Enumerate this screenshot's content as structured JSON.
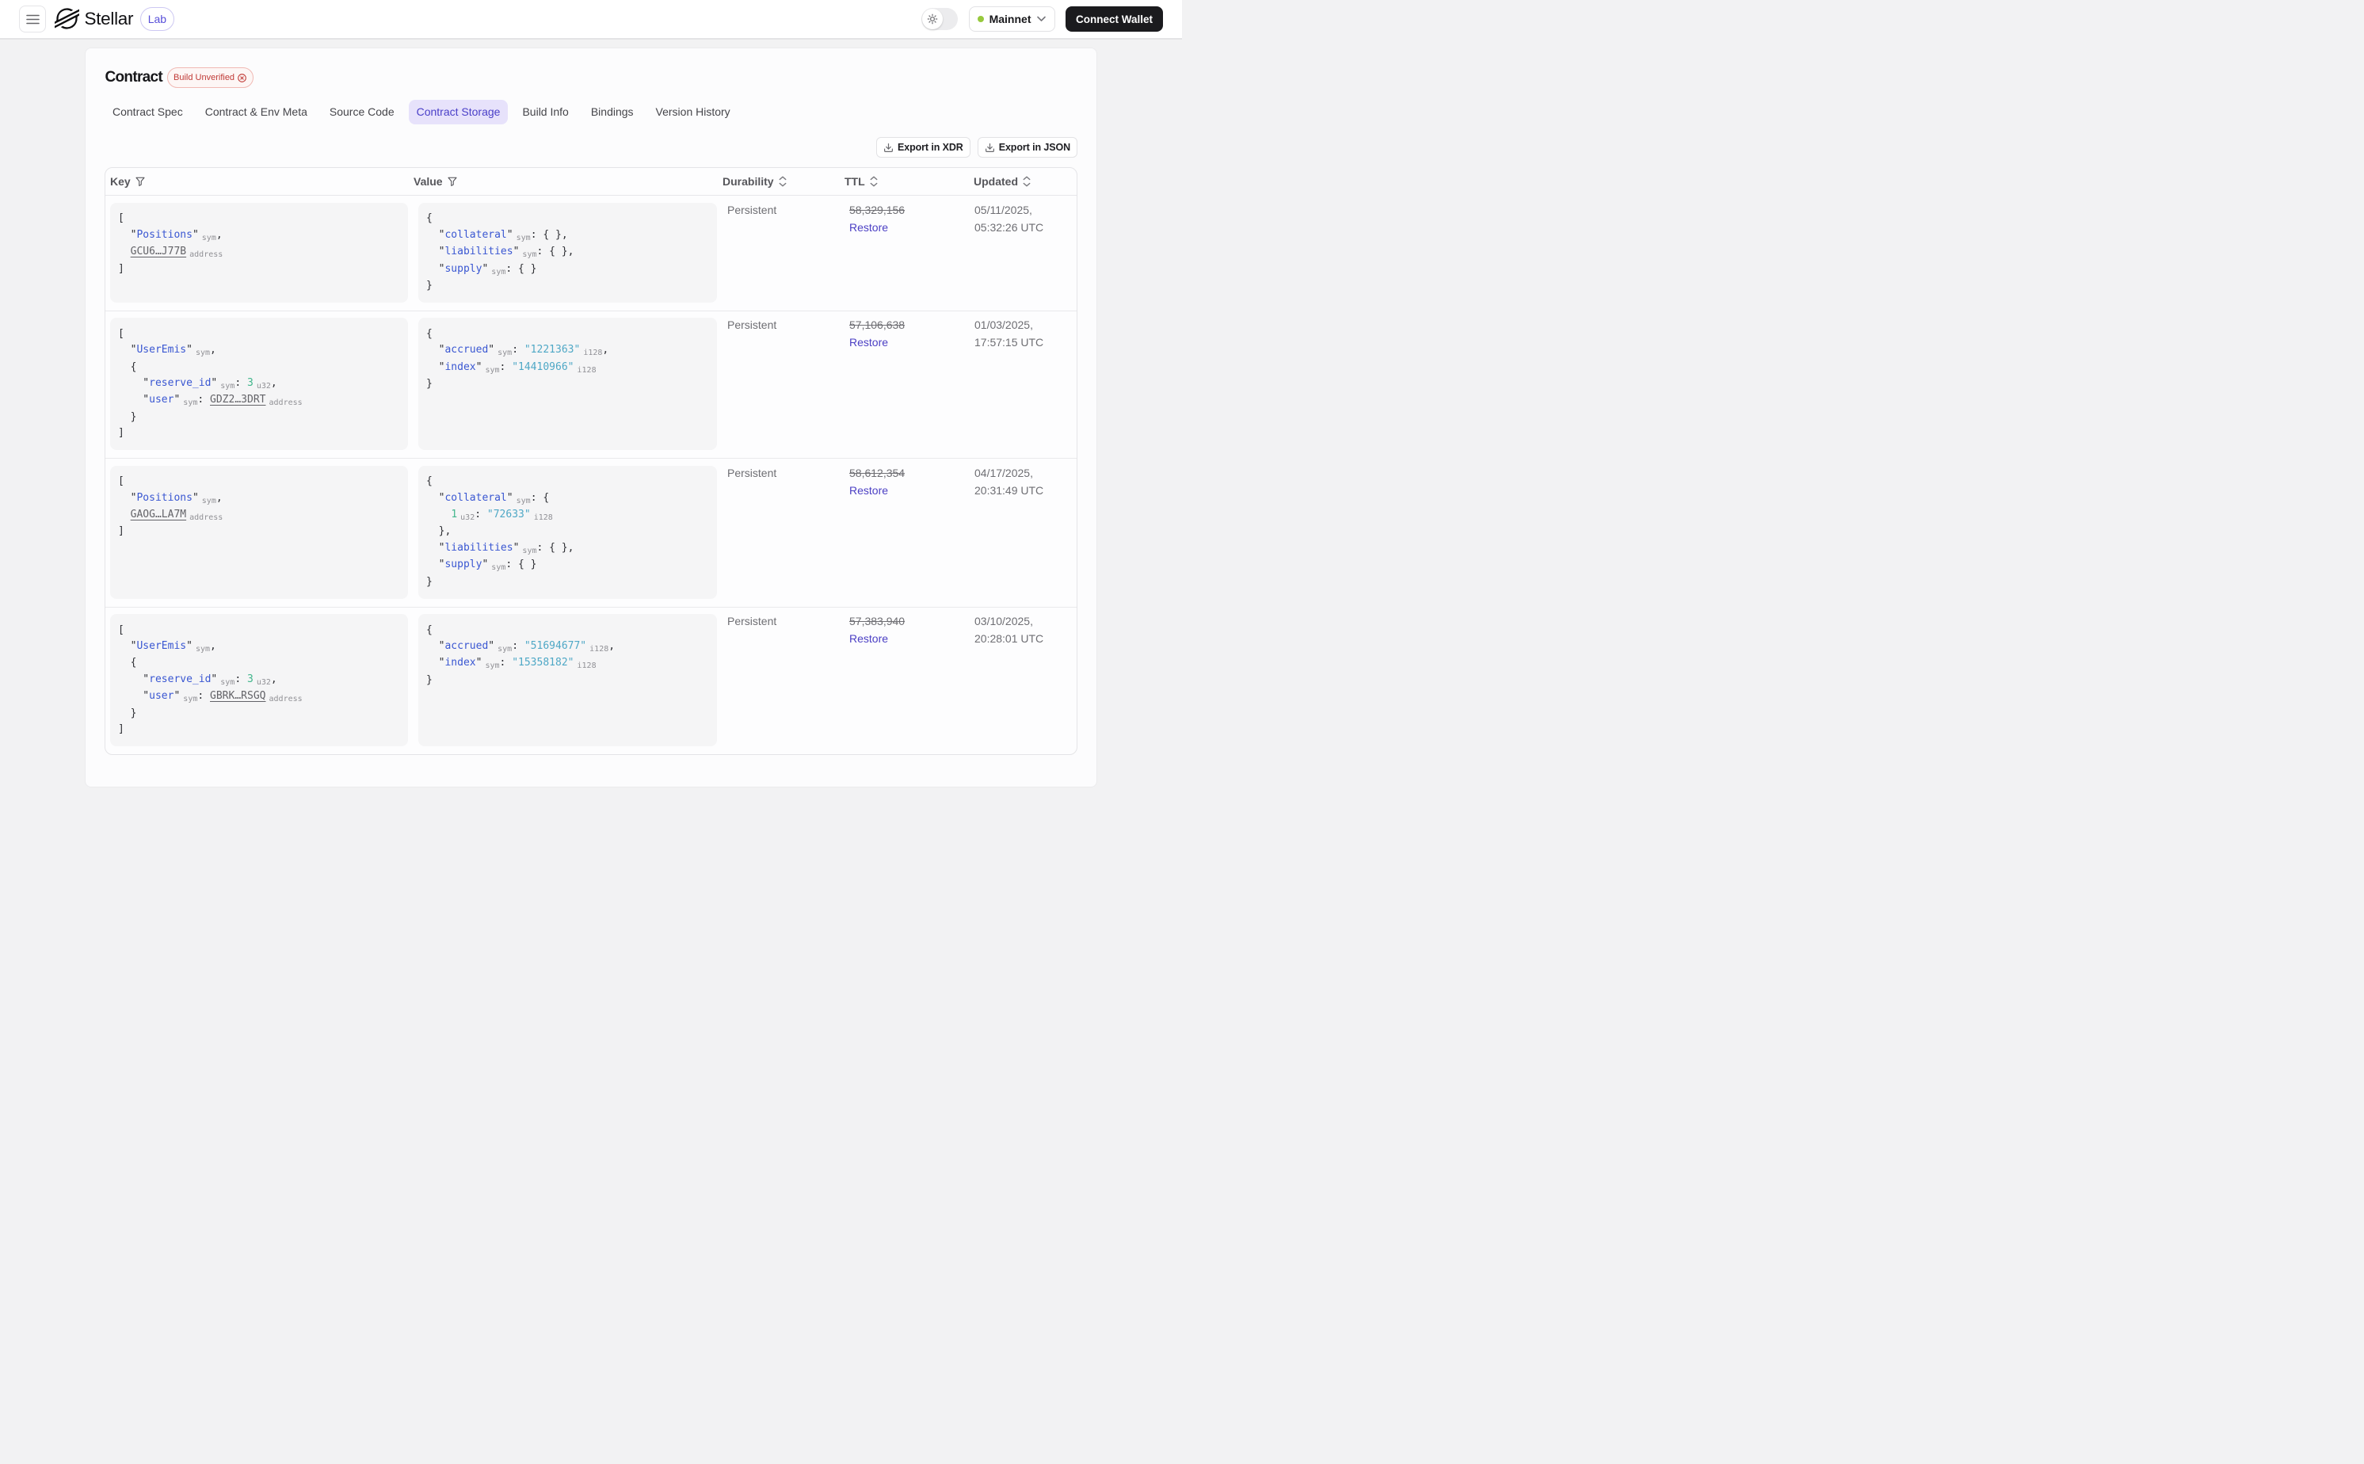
{
  "header": {
    "brand": "Stellar",
    "brand_badge": "Lab",
    "network_label": "Mainnet",
    "connect_wallet_label": "Connect Wallet",
    "icons": {
      "menu": "hamburger-icon",
      "logo": "stellar-logo",
      "theme": "sun-icon",
      "network_status": "green-dot",
      "network_expand": "chevron-down-icon"
    },
    "colors": {
      "connect_bg": "#1b1b1e",
      "network_dot": "#97c93d",
      "lab_accent": "#584fd9"
    }
  },
  "page": {
    "title": "Contract",
    "status_badge": "Build Unverified",
    "status_icon": "circle-x-icon",
    "tabs": [
      {
        "label": "Contract Spec",
        "active": false
      },
      {
        "label": "Contract & Env Meta",
        "active": false
      },
      {
        "label": "Source Code",
        "active": false
      },
      {
        "label": "Contract Storage",
        "active": true
      },
      {
        "label": "Build Info",
        "active": false
      },
      {
        "label": "Bindings",
        "active": false
      },
      {
        "label": "Version History",
        "active": false
      }
    ],
    "toolbar": {
      "export_xdr_label": "Export in XDR",
      "export_json_label": "Export in JSON",
      "export_icon": "download-icon"
    },
    "colors": {
      "tab_active_bg": "#e7e2fb",
      "tab_active_text": "#4a3fc8",
      "badge_red": "#c03a36",
      "restore_link": "#4b3fc4",
      "code_key": "#3a57d2",
      "code_string": "#4fa8c6",
      "code_number": "#41b68c"
    }
  },
  "table": {
    "columns": [
      "Key",
      "Value",
      "Durability",
      "TTL",
      "Updated"
    ],
    "column_icons": [
      "filter-icon",
      "filter-icon",
      "sort-icon",
      "sort-icon",
      "sort-icon"
    ],
    "restore_label": "Restore",
    "rows": [
      {
        "key_lines": [
          [
            {
              "t": "[",
              "c": "p"
            }
          ],
          [
            {
              "t": "  \"",
              "c": "p"
            },
            {
              "t": "Positions",
              "c": "k"
            },
            {
              "t": "\"",
              "c": "p"
            },
            {
              "t": " sym",
              "c": "sub"
            },
            {
              "t": ",",
              "c": "p"
            }
          ],
          [
            {
              "t": "  ",
              "c": "p"
            },
            {
              "t": "GCU6…J77B",
              "c": "link"
            },
            {
              "t": " address",
              "c": "sub"
            }
          ],
          [
            {
              "t": "]",
              "c": "p"
            }
          ]
        ],
        "value_lines": [
          [
            {
              "t": "{",
              "c": "p"
            }
          ],
          [
            {
              "t": "  \"",
              "c": "p"
            },
            {
              "t": "collateral",
              "c": "k"
            },
            {
              "t": "\"",
              "c": "p"
            },
            {
              "t": " sym",
              "c": "sub"
            },
            {
              "t": ": { },",
              "c": "p"
            }
          ],
          [
            {
              "t": "  \"",
              "c": "p"
            },
            {
              "t": "liabilities",
              "c": "k"
            },
            {
              "t": "\"",
              "c": "p"
            },
            {
              "t": " sym",
              "c": "sub"
            },
            {
              "t": ": { },",
              "c": "p"
            }
          ],
          [
            {
              "t": "  \"",
              "c": "p"
            },
            {
              "t": "supply",
              "c": "k"
            },
            {
              "t": "\"",
              "c": "p"
            },
            {
              "t": " sym",
              "c": "sub"
            },
            {
              "t": ": { }",
              "c": "p"
            }
          ],
          [
            {
              "t": "}",
              "c": "p"
            }
          ]
        ],
        "durability": "Persistent",
        "ttl": "58,329,156",
        "updated_line1": "05/11/2025,",
        "updated_line2": "05:32:26 UTC"
      },
      {
        "key_lines": [
          [
            {
              "t": "[",
              "c": "p"
            }
          ],
          [
            {
              "t": "  \"",
              "c": "p"
            },
            {
              "t": "UserEmis",
              "c": "k"
            },
            {
              "t": "\"",
              "c": "p"
            },
            {
              "t": " sym",
              "c": "sub"
            },
            {
              "t": ",",
              "c": "p"
            }
          ],
          [
            {
              "t": "  {",
              "c": "p"
            }
          ],
          [
            {
              "t": "    \"",
              "c": "p"
            },
            {
              "t": "reserve_id",
              "c": "k"
            },
            {
              "t": "\"",
              "c": "p"
            },
            {
              "t": " sym",
              "c": "sub"
            },
            {
              "t": ": ",
              "c": "p"
            },
            {
              "t": "3",
              "c": "n"
            },
            {
              "t": " u32",
              "c": "sub"
            },
            {
              "t": ",",
              "c": "p"
            }
          ],
          [
            {
              "t": "    \"",
              "c": "p"
            },
            {
              "t": "user",
              "c": "k"
            },
            {
              "t": "\"",
              "c": "p"
            },
            {
              "t": " sym",
              "c": "sub"
            },
            {
              "t": ": ",
              "c": "p"
            },
            {
              "t": "GDZ2…3DRT",
              "c": "link"
            },
            {
              "t": " address",
              "c": "sub"
            }
          ],
          [
            {
              "t": "  }",
              "c": "p"
            }
          ],
          [
            {
              "t": "]",
              "c": "p"
            }
          ]
        ],
        "value_lines": [
          [
            {
              "t": "{",
              "c": "p"
            }
          ],
          [
            {
              "t": "  \"",
              "c": "p"
            },
            {
              "t": "accrued",
              "c": "k"
            },
            {
              "t": "\"",
              "c": "p"
            },
            {
              "t": " sym",
              "c": "sub"
            },
            {
              "t": ": ",
              "c": "p"
            },
            {
              "t": "\"1221363\"",
              "c": "s"
            },
            {
              "t": " i128",
              "c": "sub"
            },
            {
              "t": ",",
              "c": "p"
            }
          ],
          [
            {
              "t": "  \"",
              "c": "p"
            },
            {
              "t": "index",
              "c": "k"
            },
            {
              "t": "\"",
              "c": "p"
            },
            {
              "t": " sym",
              "c": "sub"
            },
            {
              "t": ": ",
              "c": "p"
            },
            {
              "t": "\"14410966\"",
              "c": "s"
            },
            {
              "t": " i128",
              "c": "sub"
            }
          ],
          [
            {
              "t": "}",
              "c": "p"
            }
          ]
        ],
        "durability": "Persistent",
        "ttl": "57,106,638",
        "updated_line1": "01/03/2025,",
        "updated_line2": "17:57:15 UTC"
      },
      {
        "key_lines": [
          [
            {
              "t": "[",
              "c": "p"
            }
          ],
          [
            {
              "t": "  \"",
              "c": "p"
            },
            {
              "t": "Positions",
              "c": "k"
            },
            {
              "t": "\"",
              "c": "p"
            },
            {
              "t": " sym",
              "c": "sub"
            },
            {
              "t": ",",
              "c": "p"
            }
          ],
          [
            {
              "t": "  ",
              "c": "p"
            },
            {
              "t": "GAOG…LA7M",
              "c": "link"
            },
            {
              "t": " address",
              "c": "sub"
            }
          ],
          [
            {
              "t": "]",
              "c": "p"
            }
          ]
        ],
        "value_lines": [
          [
            {
              "t": "{",
              "c": "p"
            }
          ],
          [
            {
              "t": "  \"",
              "c": "p"
            },
            {
              "t": "collateral",
              "c": "k"
            },
            {
              "t": "\"",
              "c": "p"
            },
            {
              "t": " sym",
              "c": "sub"
            },
            {
              "t": ": {",
              "c": "p"
            }
          ],
          [
            {
              "t": "    ",
              "c": "p"
            },
            {
              "t": "1",
              "c": "n"
            },
            {
              "t": " u32",
              "c": "sub"
            },
            {
              "t": ": ",
              "c": "p"
            },
            {
              "t": "\"72633\"",
              "c": "s"
            },
            {
              "t": " i128",
              "c": "sub"
            }
          ],
          [
            {
              "t": "  },",
              "c": "p"
            }
          ],
          [
            {
              "t": "  \"",
              "c": "p"
            },
            {
              "t": "liabilities",
              "c": "k"
            },
            {
              "t": "\"",
              "c": "p"
            },
            {
              "t": " sym",
              "c": "sub"
            },
            {
              "t": ": { },",
              "c": "p"
            }
          ],
          [
            {
              "t": "  \"",
              "c": "p"
            },
            {
              "t": "supply",
              "c": "k"
            },
            {
              "t": "\"",
              "c": "p"
            },
            {
              "t": " sym",
              "c": "sub"
            },
            {
              "t": ": { }",
              "c": "p"
            }
          ],
          [
            {
              "t": "}",
              "c": "p"
            }
          ]
        ],
        "durability": "Persistent",
        "ttl": "58,612,354",
        "updated_line1": "04/17/2025,",
        "updated_line2": "20:31:49 UTC"
      },
      {
        "key_lines": [
          [
            {
              "t": "[",
              "c": "p"
            }
          ],
          [
            {
              "t": "  \"",
              "c": "p"
            },
            {
              "t": "UserEmis",
              "c": "k"
            },
            {
              "t": "\"",
              "c": "p"
            },
            {
              "t": " sym",
              "c": "sub"
            },
            {
              "t": ",",
              "c": "p"
            }
          ],
          [
            {
              "t": "  {",
              "c": "p"
            }
          ],
          [
            {
              "t": "    \"",
              "c": "p"
            },
            {
              "t": "reserve_id",
              "c": "k"
            },
            {
              "t": "\"",
              "c": "p"
            },
            {
              "t": " sym",
              "c": "sub"
            },
            {
              "t": ": ",
              "c": "p"
            },
            {
              "t": "3",
              "c": "n"
            },
            {
              "t": " u32",
              "c": "sub"
            },
            {
              "t": ",",
              "c": "p"
            }
          ],
          [
            {
              "t": "    \"",
              "c": "p"
            },
            {
              "t": "user",
              "c": "k"
            },
            {
              "t": "\"",
              "c": "p"
            },
            {
              "t": " sym",
              "c": "sub"
            },
            {
              "t": ": ",
              "c": "p"
            },
            {
              "t": "GBRK…RSGQ",
              "c": "link"
            },
            {
              "t": " address",
              "c": "sub"
            }
          ],
          [
            {
              "t": "  }",
              "c": "p"
            }
          ],
          [
            {
              "t": "]",
              "c": "p"
            }
          ]
        ],
        "value_lines": [
          [
            {
              "t": "{",
              "c": "p"
            }
          ],
          [
            {
              "t": "  \"",
              "c": "p"
            },
            {
              "t": "accrued",
              "c": "k"
            },
            {
              "t": "\"",
              "c": "p"
            },
            {
              "t": " sym",
              "c": "sub"
            },
            {
              "t": ": ",
              "c": "p"
            },
            {
              "t": "\"51694677\"",
              "c": "s"
            },
            {
              "t": " i128",
              "c": "sub"
            },
            {
              "t": ",",
              "c": "p"
            }
          ],
          [
            {
              "t": "  \"",
              "c": "p"
            },
            {
              "t": "index",
              "c": "k"
            },
            {
              "t": "\"",
              "c": "p"
            },
            {
              "t": " sym",
              "c": "sub"
            },
            {
              "t": ": ",
              "c": "p"
            },
            {
              "t": "\"15358182\"",
              "c": "s"
            },
            {
              "t": " i128",
              "c": "sub"
            }
          ],
          [
            {
              "t": "}",
              "c": "p"
            }
          ]
        ],
        "durability": "Persistent",
        "ttl": "57,383,940",
        "updated_line1": "03/10/2025,",
        "updated_line2": "20:28:01 UTC"
      }
    ]
  }
}
